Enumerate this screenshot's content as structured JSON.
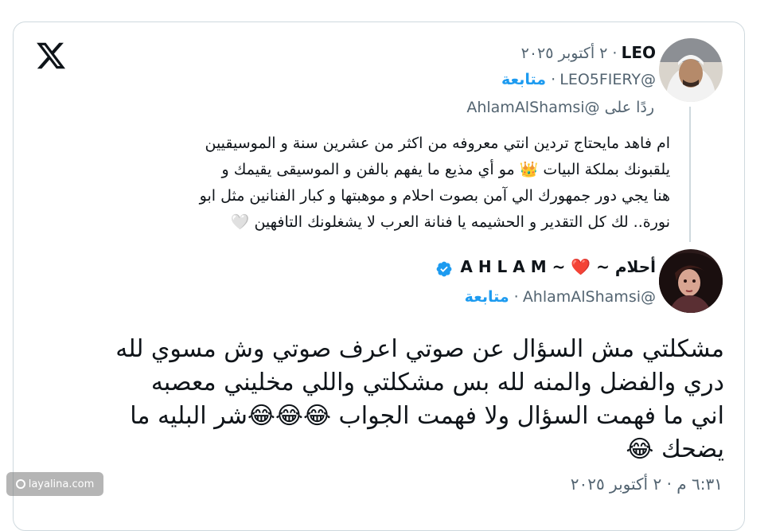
{
  "reply_tweet": {
    "author_name": "LEO",
    "date": "٢ أكتوبر ٢٠٢٥",
    "handle": "@LEO5FIERY",
    "follow_label": "متابعة",
    "replying_to": "ردًا على @AhlamAlShamsi",
    "body_lines": [
      "ام فاهد مايحتاج تردين انتي معروفه من اكثر من عشرين سنة و الموسيقيين",
      "يلقبونك بملكة البيات 👑 مو أي مذيع ما يفهم بالفن و الموسيقى يقيمك و",
      "هنا يجي دور جمهورك الي آمن بصوت احلام و موهبتها و كبار الفنانين مثل ابو",
      "نورة.. لك كل التقدير و الحشيمه يا فنانة العرب لا يشغلونك التافهين 🤍"
    ]
  },
  "main_tweet": {
    "author_name": "أحلام ~ ❤️ ~ A H L A M",
    "handle": "@AhlamAlShamsi",
    "follow_label": "متابعة",
    "body_lines": [
      "مشكلتي مش السؤال عن صوتي اعرف صوتي وش مسوي لله",
      "دري والفضل والمنه لله بس مشكلتي واللي مخليني معصبه",
      "اني ما فهمت السؤال ولا فهمت الجواب 😂😂😂شر البليه ما",
      "يضحك 😂"
    ],
    "timestamp": "٦:٣١ م · ٢ أكتوبر ٢٠٢٥"
  },
  "brand": {
    "logo": "x-logo-icon",
    "verified_color": "#1d9bf0",
    "follow_color": "#1d9bf0"
  },
  "watermark": {
    "text": "layalina.com"
  }
}
